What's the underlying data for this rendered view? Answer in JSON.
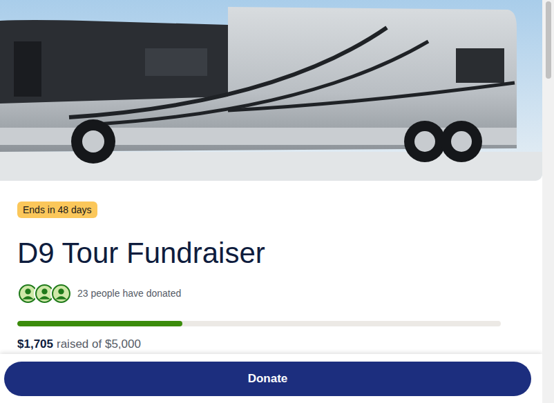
{
  "campaign": {
    "badge": "Ends in 48 days",
    "title": "D9 Tour Fundraiser",
    "donors_text": "23 people have donated"
  },
  "progress": {
    "level": 0.341,
    "raised": "$1,705",
    "goal_text": "raised of $5,000"
  },
  "donate_button": "Donate"
}
